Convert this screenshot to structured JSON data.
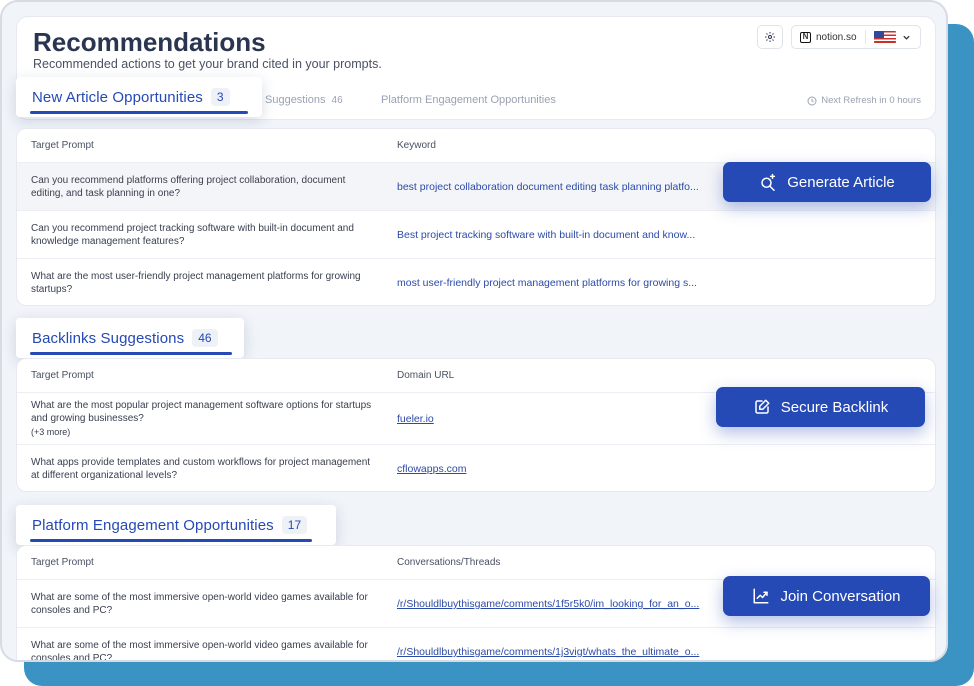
{
  "header": {
    "title": "Recommendations",
    "subtitle": "Recommended actions to get your brand cited in your prompts.",
    "domain": "notion.so",
    "settings_icon": "gear-icon",
    "tabs": [
      {
        "label": "New Article Opportunities",
        "count": "3"
      },
      {
        "label": "Suggestions",
        "count": "46"
      },
      {
        "label": "Platform Engagement Opportunities",
        "count": ""
      }
    ],
    "refresh": "Next Refresh in 0 hours"
  },
  "articles": {
    "columns": [
      "Target Prompt",
      "Keyword"
    ],
    "rows": [
      {
        "prompt": "Can you recommend platforms offering project collaboration, document editing, and task planning in one?",
        "keyword": "best project collaboration document editing task planning platfo..."
      },
      {
        "prompt": "Can you recommend project tracking software with built-in document and knowledge management features?",
        "keyword": "Best project tracking software with built-in document and know..."
      },
      {
        "prompt": "What are the most user-friendly project management platforms for growing startups?",
        "keyword": "most user-friendly project management platforms for growing s..."
      }
    ],
    "cta": "Generate Article"
  },
  "backlinks": {
    "label": "Backlinks Suggestions",
    "count": "46",
    "columns": [
      "Target Prompt",
      "Domain URL"
    ],
    "rows": [
      {
        "prompt": "What are the most popular project management software options for startups and growing businesses?",
        "extra": "(+3 more)",
        "url": "fueler.io"
      },
      {
        "prompt": "What apps provide templates and custom workflows for project management at different organizational levels?",
        "url": "cflowapps.com"
      }
    ],
    "cta": "Secure Backlink"
  },
  "platform": {
    "label": "Platform Engagement Opportunities",
    "count": "17",
    "columns": [
      "Target Prompt",
      "Conversations/Threads"
    ],
    "rows": [
      {
        "prompt": "What are some of the most immersive open-world video games available for consoles and PC?",
        "thread": "/r/Shouldlbuythisgame/comments/1f5r5k0/im_looking_for_an_o..."
      },
      {
        "prompt": "What are some of the most immersive open-world video games available for consoles and PC?",
        "thread": "/r/Shouldlbuythisgame/comments/1j3vigt/whats_the_ultimate_o..."
      }
    ],
    "cta": "Join Conversation"
  },
  "colors": {
    "accent": "#2549b5",
    "backdrop": "#3b93c4"
  }
}
